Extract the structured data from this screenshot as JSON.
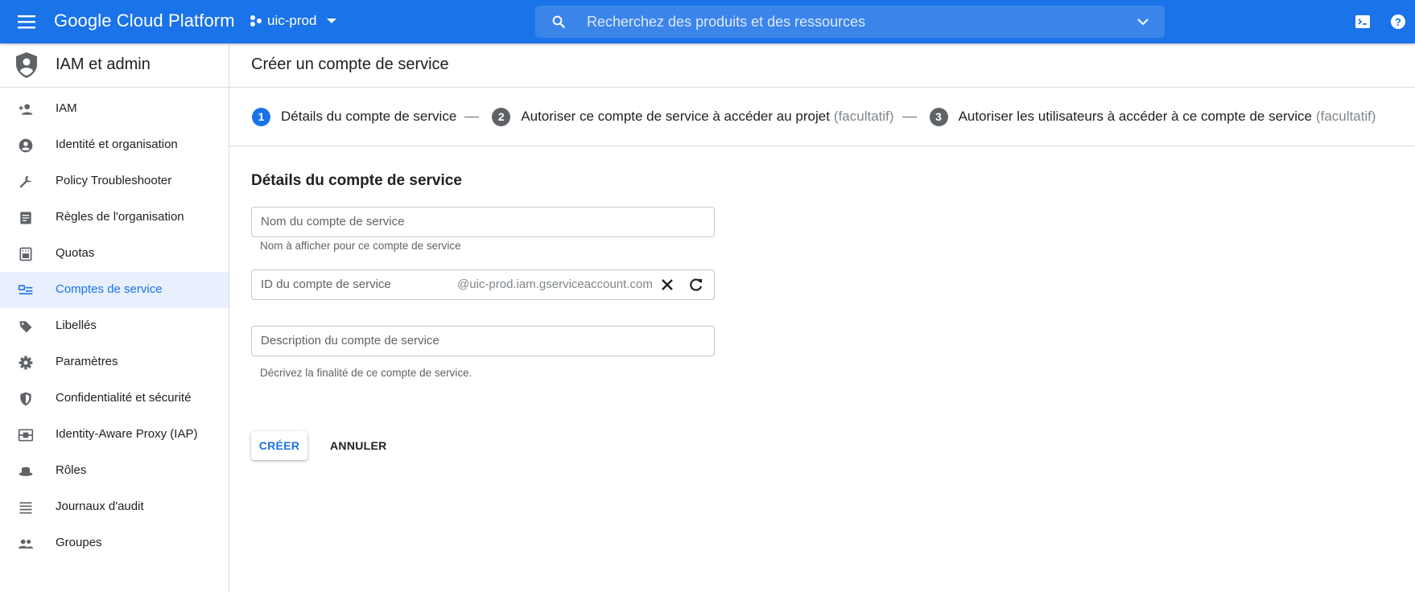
{
  "topbar": {
    "brand": "Google Cloud Platform",
    "project": "uic-prod",
    "search_placeholder": "Recherchez des produits et des ressources"
  },
  "sidebar": {
    "title": "IAM et admin",
    "items": [
      {
        "label": "IAM",
        "icon": "person-add-icon"
      },
      {
        "label": "Identité et organisation",
        "icon": "account-circle-icon"
      },
      {
        "label": "Policy Troubleshooter",
        "icon": "wrench-icon"
      },
      {
        "label": "Règles de l'organisation",
        "icon": "article-icon"
      },
      {
        "label": "Quotas",
        "icon": "quotas-icon"
      },
      {
        "label": "Comptes de service",
        "icon": "service-account-icon",
        "active": true
      },
      {
        "label": "Libellés",
        "icon": "label-icon"
      },
      {
        "label": "Paramètres",
        "icon": "gear-icon"
      },
      {
        "label": "Confidentialité et sécurité",
        "icon": "shield-icon"
      },
      {
        "label": "Identity-Aware Proxy (IAP)",
        "icon": "iap-icon"
      },
      {
        "label": "Rôles",
        "icon": "hat-icon"
      },
      {
        "label": "Journaux d'audit",
        "icon": "list-icon"
      },
      {
        "label": "Groupes",
        "icon": "group-icon"
      }
    ]
  },
  "main": {
    "page_title": "Créer un compte de service",
    "steps": [
      {
        "number": "1",
        "label": "Détails du compte de service",
        "optional": ""
      },
      {
        "number": "2",
        "label": "Autoriser ce compte de service à accéder au projet",
        "optional": "(facultatif)"
      },
      {
        "number": "3",
        "label": "Autoriser les utilisateurs à accéder à ce compte de service",
        "optional": "(facultatif)"
      }
    ],
    "section_title": "Détails du compte de service",
    "form": {
      "name_placeholder": "Nom du compte de service",
      "name_hint": "Nom à afficher pour ce compte de service",
      "id_placeholder": "ID du compte de service",
      "id_suffix": "@uic-prod.iam.gserviceaccount.com",
      "description_placeholder": "Description du compte de service",
      "description_hint": "Décrivez la finalité de ce compte de service."
    },
    "buttons": {
      "create": "CRÉER",
      "cancel": "ANNULER"
    }
  },
  "colors": {
    "primary": "#1a73e8",
    "active_bg": "#e8f0fe",
    "border": "#dadce0"
  }
}
